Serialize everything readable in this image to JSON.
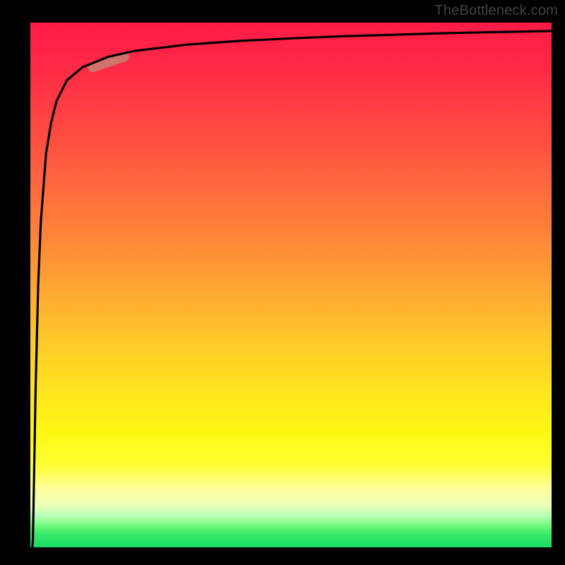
{
  "watermark": "TheBottleneck.com",
  "colors": {
    "background": "#000000",
    "curve": "#000000",
    "marker": "#cc7a70",
    "watermark_text": "#444444"
  },
  "chart_data": {
    "type": "line",
    "title": "",
    "xlabel": "",
    "ylabel": "",
    "xlim": [
      0,
      100
    ],
    "ylim": [
      0,
      100
    ],
    "series": [
      {
        "name": "bottleneck-curve",
        "x": [
          0.5,
          1,
          1.5,
          2,
          3,
          4,
          5,
          7,
          10,
          15,
          20,
          30,
          40,
          50,
          60,
          70,
          80,
          90,
          100
        ],
        "y": [
          2,
          30,
          50,
          62,
          75,
          81,
          85,
          89,
          91.5,
          93.5,
          94.6,
          95.8,
          96.5,
          97,
          97.4,
          97.7,
          98,
          98.2,
          98.4
        ]
      }
    ],
    "marker": {
      "name": "highlight-segment",
      "x_range": [
        12,
        18
      ],
      "y_range": [
        91.5,
        93.5
      ]
    },
    "background_gradient": {
      "direction": "top-to-bottom",
      "stops": [
        {
          "pos": 0.0,
          "color": "#ff1a46"
        },
        {
          "pos": 0.5,
          "color": "#ffa433"
        },
        {
          "pos": 0.8,
          "color": "#fff714"
        },
        {
          "pos": 0.92,
          "color": "#eaffb8"
        },
        {
          "pos": 1.0,
          "color": "#17db62"
        }
      ]
    }
  }
}
